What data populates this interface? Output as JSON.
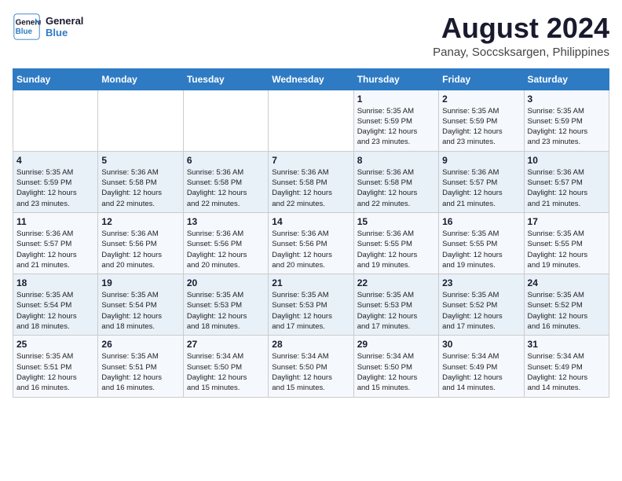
{
  "logo": {
    "line1": "General",
    "line2": "Blue"
  },
  "title": "August 2024",
  "subtitle": "Panay, Soccsksargen, Philippines",
  "weekdays": [
    "Sunday",
    "Monday",
    "Tuesday",
    "Wednesday",
    "Thursday",
    "Friday",
    "Saturday"
  ],
  "weeks": [
    [
      {
        "day": "",
        "info": ""
      },
      {
        "day": "",
        "info": ""
      },
      {
        "day": "",
        "info": ""
      },
      {
        "day": "",
        "info": ""
      },
      {
        "day": "1",
        "info": "Sunrise: 5:35 AM\nSunset: 5:59 PM\nDaylight: 12 hours\nand 23 minutes."
      },
      {
        "day": "2",
        "info": "Sunrise: 5:35 AM\nSunset: 5:59 PM\nDaylight: 12 hours\nand 23 minutes."
      },
      {
        "day": "3",
        "info": "Sunrise: 5:35 AM\nSunset: 5:59 PM\nDaylight: 12 hours\nand 23 minutes."
      }
    ],
    [
      {
        "day": "4",
        "info": "Sunrise: 5:35 AM\nSunset: 5:59 PM\nDaylight: 12 hours\nand 23 minutes."
      },
      {
        "day": "5",
        "info": "Sunrise: 5:36 AM\nSunset: 5:58 PM\nDaylight: 12 hours\nand 22 minutes."
      },
      {
        "day": "6",
        "info": "Sunrise: 5:36 AM\nSunset: 5:58 PM\nDaylight: 12 hours\nand 22 minutes."
      },
      {
        "day": "7",
        "info": "Sunrise: 5:36 AM\nSunset: 5:58 PM\nDaylight: 12 hours\nand 22 minutes."
      },
      {
        "day": "8",
        "info": "Sunrise: 5:36 AM\nSunset: 5:58 PM\nDaylight: 12 hours\nand 22 minutes."
      },
      {
        "day": "9",
        "info": "Sunrise: 5:36 AM\nSunset: 5:57 PM\nDaylight: 12 hours\nand 21 minutes."
      },
      {
        "day": "10",
        "info": "Sunrise: 5:36 AM\nSunset: 5:57 PM\nDaylight: 12 hours\nand 21 minutes."
      }
    ],
    [
      {
        "day": "11",
        "info": "Sunrise: 5:36 AM\nSunset: 5:57 PM\nDaylight: 12 hours\nand 21 minutes."
      },
      {
        "day": "12",
        "info": "Sunrise: 5:36 AM\nSunset: 5:56 PM\nDaylight: 12 hours\nand 20 minutes."
      },
      {
        "day": "13",
        "info": "Sunrise: 5:36 AM\nSunset: 5:56 PM\nDaylight: 12 hours\nand 20 minutes."
      },
      {
        "day": "14",
        "info": "Sunrise: 5:36 AM\nSunset: 5:56 PM\nDaylight: 12 hours\nand 20 minutes."
      },
      {
        "day": "15",
        "info": "Sunrise: 5:36 AM\nSunset: 5:55 PM\nDaylight: 12 hours\nand 19 minutes."
      },
      {
        "day": "16",
        "info": "Sunrise: 5:35 AM\nSunset: 5:55 PM\nDaylight: 12 hours\nand 19 minutes."
      },
      {
        "day": "17",
        "info": "Sunrise: 5:35 AM\nSunset: 5:55 PM\nDaylight: 12 hours\nand 19 minutes."
      }
    ],
    [
      {
        "day": "18",
        "info": "Sunrise: 5:35 AM\nSunset: 5:54 PM\nDaylight: 12 hours\nand 18 minutes."
      },
      {
        "day": "19",
        "info": "Sunrise: 5:35 AM\nSunset: 5:54 PM\nDaylight: 12 hours\nand 18 minutes."
      },
      {
        "day": "20",
        "info": "Sunrise: 5:35 AM\nSunset: 5:53 PM\nDaylight: 12 hours\nand 18 minutes."
      },
      {
        "day": "21",
        "info": "Sunrise: 5:35 AM\nSunset: 5:53 PM\nDaylight: 12 hours\nand 17 minutes."
      },
      {
        "day": "22",
        "info": "Sunrise: 5:35 AM\nSunset: 5:53 PM\nDaylight: 12 hours\nand 17 minutes."
      },
      {
        "day": "23",
        "info": "Sunrise: 5:35 AM\nSunset: 5:52 PM\nDaylight: 12 hours\nand 17 minutes."
      },
      {
        "day": "24",
        "info": "Sunrise: 5:35 AM\nSunset: 5:52 PM\nDaylight: 12 hours\nand 16 minutes."
      }
    ],
    [
      {
        "day": "25",
        "info": "Sunrise: 5:35 AM\nSunset: 5:51 PM\nDaylight: 12 hours\nand 16 minutes."
      },
      {
        "day": "26",
        "info": "Sunrise: 5:35 AM\nSunset: 5:51 PM\nDaylight: 12 hours\nand 16 minutes."
      },
      {
        "day": "27",
        "info": "Sunrise: 5:34 AM\nSunset: 5:50 PM\nDaylight: 12 hours\nand 15 minutes."
      },
      {
        "day": "28",
        "info": "Sunrise: 5:34 AM\nSunset: 5:50 PM\nDaylight: 12 hours\nand 15 minutes."
      },
      {
        "day": "29",
        "info": "Sunrise: 5:34 AM\nSunset: 5:50 PM\nDaylight: 12 hours\nand 15 minutes."
      },
      {
        "day": "30",
        "info": "Sunrise: 5:34 AM\nSunset: 5:49 PM\nDaylight: 12 hours\nand 14 minutes."
      },
      {
        "day": "31",
        "info": "Sunrise: 5:34 AM\nSunset: 5:49 PM\nDaylight: 12 hours\nand 14 minutes."
      }
    ]
  ]
}
